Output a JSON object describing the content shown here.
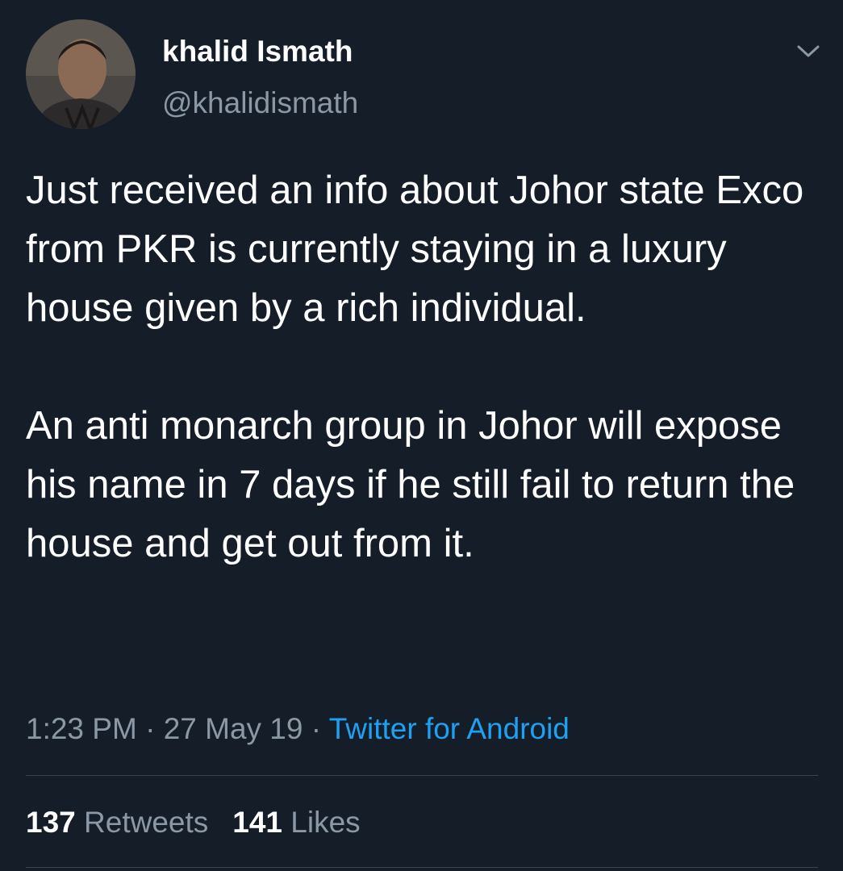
{
  "tweet": {
    "author": {
      "display_name": "khalid Ismath",
      "handle": "@khalidismath",
      "avatar_icon": "profile-photo"
    },
    "menu_icon": "chevron-down-icon",
    "body": {
      "paragraph_1": "Just received an info about Johor state Excо from PKR is currently staying in a luxury house given by a rich individual.",
      "paragraph_2": "An anti monarch group in Johor will expose his name in 7 days if he still fail to return the house and get out from it."
    },
    "meta": {
      "time": "1:23 PM",
      "separator": "·",
      "date": "27 May 19",
      "source": "Twitter for Android"
    },
    "stats": {
      "retweets_count": "137",
      "retweets_label": "Retweets",
      "likes_count": "141",
      "likes_label": "Likes"
    },
    "colors": {
      "background": "#151d28",
      "text_primary": "#ffffff",
      "text_secondary": "#8b98a5",
      "link": "#1da1f2",
      "divider": "#38444d"
    }
  }
}
